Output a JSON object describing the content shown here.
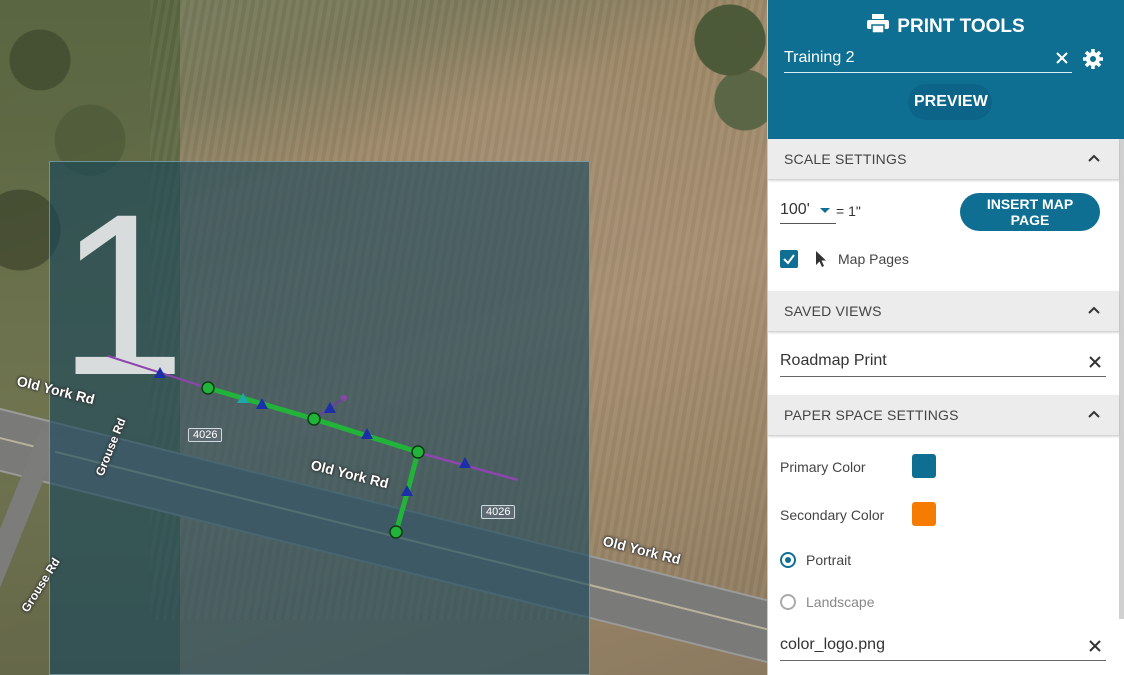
{
  "map": {
    "page_number": "1",
    "road_labels": [
      "Old York Rd",
      "Old York Rd",
      "Old York Rd",
      "Grouse Rd",
      "Grouse Rd"
    ],
    "route_shields": [
      "4026",
      "4026"
    ]
  },
  "panel": {
    "title": "PRINT TOOLS",
    "name_value": "Training 2",
    "preview_label": "PREVIEW",
    "sections": {
      "scale": {
        "header": "SCALE SETTINGS",
        "scale_value": "100'",
        "equals": "= 1\"",
        "insert_label": "INSERT MAP PAGE",
        "map_pages_label": "Map Pages",
        "map_pages_checked": true
      },
      "saved_views": {
        "header": "SAVED VIEWS",
        "value": "Roadmap Print"
      },
      "paper": {
        "header": "PAPER SPACE SETTINGS",
        "primary_label": "Primary Color",
        "primary_color": "#0e6f93",
        "secondary_label": "Secondary Color",
        "secondary_color": "#f57c00",
        "portrait_label": "Portrait",
        "landscape_label": "Landscape",
        "orientation": "Portrait",
        "logo_file": "color_logo.png"
      }
    }
  },
  "colors": {
    "accent": "#0e6f93",
    "line_green": "#22b33a",
    "line_purple": "#8e44ad",
    "marker_blue": "#1d2fa8"
  }
}
